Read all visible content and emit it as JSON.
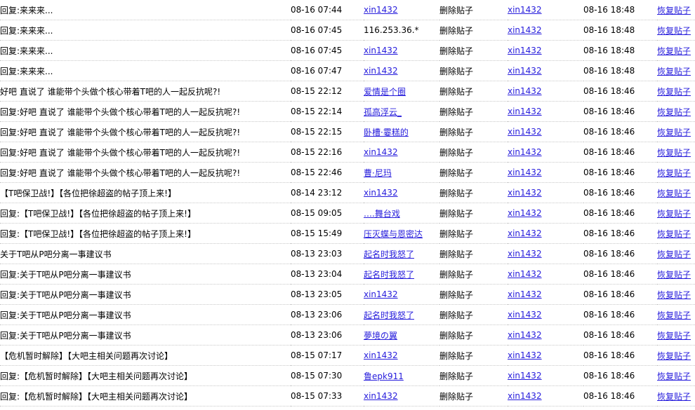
{
  "rows": [
    {
      "title": "回复:来来来...",
      "time": "08-16 07:44",
      "author": "xin1432",
      "author_is_link": true,
      "operation": "删除贴子",
      "operator": "xin1432",
      "op_time": "08-16 18:48",
      "action": "恢复贴子"
    },
    {
      "title": "回复:来来来...",
      "time": "08-16 07:45",
      "author": "116.253.36.*",
      "author_is_link": false,
      "operation": "删除贴子",
      "operator": "xin1432",
      "op_time": "08-16 18:48",
      "action": "恢复贴子"
    },
    {
      "title": "回复:来来来...",
      "time": "08-16 07:45",
      "author": "xin1432",
      "author_is_link": true,
      "operation": "删除贴子",
      "operator": "xin1432",
      "op_time": "08-16 18:48",
      "action": "恢复贴子"
    },
    {
      "title": "回复:来来来...",
      "time": "08-16 07:47",
      "author": "xin1432",
      "author_is_link": true,
      "operation": "删除贴子",
      "operator": "xin1432",
      "op_time": "08-16 18:48",
      "action": "恢复贴子"
    },
    {
      "title": "好吧 直说了 谁能带个头做个核心带着T吧的人一起反抗呢?!",
      "time": "08-15 22:12",
      "author": "爱情是个圈",
      "author_is_link": true,
      "operation": "删除贴子",
      "operator": "xin1432",
      "op_time": "08-16 18:46",
      "action": "恢复贴子"
    },
    {
      "title": "回复:好吧 直说了 谁能带个头做个核心带着T吧的人一起反抗呢?!",
      "time": "08-15 22:14",
      "author": "孤高浮云_",
      "author_is_link": true,
      "operation": "删除贴子",
      "operator": "xin1432",
      "op_time": "08-16 18:46",
      "action": "恢复贴子"
    },
    {
      "title": "回复:好吧 直说了 谁能带个头做个核心带着T吧的人一起反抗呢?!",
      "time": "08-15 22:15",
      "author": "卧槽·霎糕的",
      "author_is_link": true,
      "operation": "删除贴子",
      "operator": "xin1432",
      "op_time": "08-16 18:46",
      "action": "恢复贴子"
    },
    {
      "title": "回复:好吧 直说了 谁能带个头做个核心带着T吧的人一起反抗呢?!",
      "time": "08-15 22:16",
      "author": "xin1432",
      "author_is_link": true,
      "operation": "删除贴子",
      "operator": "xin1432",
      "op_time": "08-16 18:46",
      "action": "恢复贴子"
    },
    {
      "title": "回复:好吧 直说了 谁能带个头做个核心带着T吧的人一起反抗呢?!",
      "time": "08-15 22:46",
      "author": "曹·尼玛",
      "author_is_link": true,
      "operation": "删除贴子",
      "operator": "xin1432",
      "op_time": "08-16 18:46",
      "action": "恢复贴子"
    },
    {
      "title": "【T吧保卫战!】【各位把徐超盗的帖子顶上来!】",
      "time": "08-14 23:12",
      "author": "xin1432",
      "author_is_link": true,
      "operation": "删除贴子",
      "operator": "xin1432",
      "op_time": "08-16 18:46",
      "action": "恢复贴子"
    },
    {
      "title": "回复:【T吧保卫战!】【各位把徐超盗的帖子顶上来!】",
      "time": "08-15 09:05",
      "author": "….舞台戏",
      "author_is_link": true,
      "operation": "删除贴子",
      "operator": "xin1432",
      "op_time": "08-16 18:46",
      "action": "恢复贴子"
    },
    {
      "title": "回复:【T吧保卫战!】【各位把徐超盗的帖子顶上来!】",
      "time": "08-15 15:49",
      "author": "压灭蝶与恩密达",
      "author_is_link": true,
      "operation": "删除贴子",
      "operator": "xin1432",
      "op_time": "08-16 18:46",
      "action": "恢复贴子"
    },
    {
      "title": "关于T吧从P吧分离一事建议书",
      "time": "08-13 23:03",
      "author": "起名时我怒了",
      "author_is_link": true,
      "operation": "删除贴子",
      "operator": "xin1432",
      "op_time": "08-16 18:46",
      "action": "恢复贴子"
    },
    {
      "title": "回复:关于T吧从P吧分离一事建议书",
      "time": "08-13 23:04",
      "author": "起名时我怒了",
      "author_is_link": true,
      "operation": "删除贴子",
      "operator": "xin1432",
      "op_time": "08-16 18:46",
      "action": "恢复贴子"
    },
    {
      "title": "回复:关于T吧从P吧分离一事建议书",
      "time": "08-13 23:05",
      "author": "xin1432",
      "author_is_link": true,
      "operation": "删除贴子",
      "operator": "xin1432",
      "op_time": "08-16 18:46",
      "action": "恢复贴子"
    },
    {
      "title": "回复:关于T吧从P吧分离一事建议书",
      "time": "08-13 23:06",
      "author": "起名时我怒了",
      "author_is_link": true,
      "operation": "删除贴子",
      "operator": "xin1432",
      "op_time": "08-16 18:46",
      "action": "恢复贴子"
    },
    {
      "title": "回复:关于T吧从P吧分离一事建议书",
      "time": "08-13 23:06",
      "author": "夢境の翼",
      "author_is_link": true,
      "operation": "删除贴子",
      "operator": "xin1432",
      "op_time": "08-16 18:46",
      "action": "恢复贴子"
    },
    {
      "title": "【危机暂时解除】【大吧主相关问题再次讨论】",
      "time": "08-15 07:17",
      "author": "xin1432",
      "author_is_link": true,
      "operation": "删除贴子",
      "operator": "xin1432",
      "op_time": "08-16 18:46",
      "action": "恢复贴子"
    },
    {
      "title": "回复:【危机暂时解除】【大吧主相关问题再次讨论】",
      "time": "08-15 07:30",
      "author": "鲁epk911",
      "author_is_link": true,
      "operation": "删除贴子",
      "operator": "xin1432",
      "op_time": "08-16 18:46",
      "action": "恢复贴子"
    },
    {
      "title": "回复:【危机暂时解除】【大吧主相关问题再次讨论】",
      "time": "08-15 07:33",
      "author": "xin1432",
      "author_is_link": true,
      "operation": "删除贴子",
      "operator": "xin1432",
      "op_time": "08-16 18:46",
      "action": "恢复贴子"
    }
  ]
}
